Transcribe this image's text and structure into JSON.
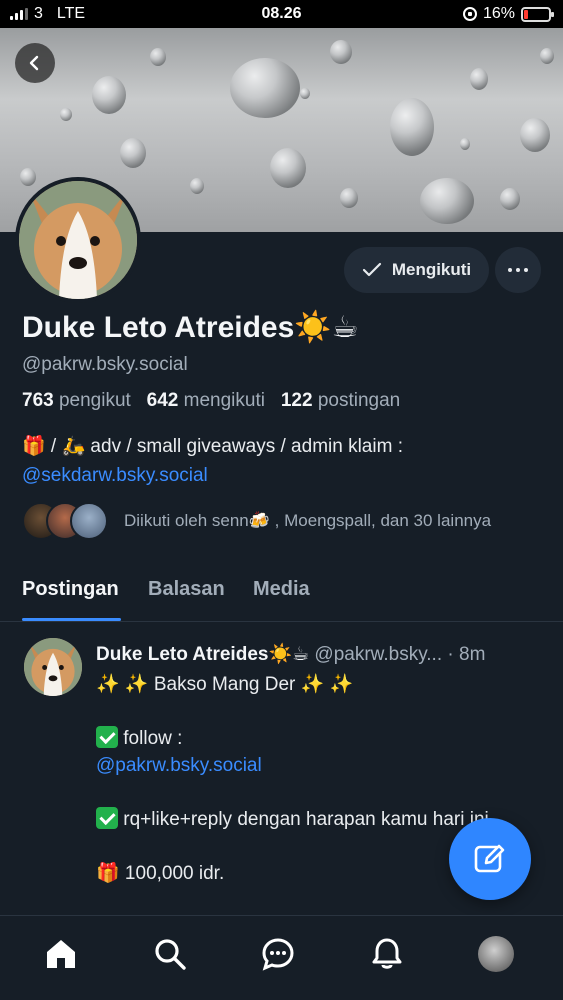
{
  "status_bar": {
    "carrier": "3",
    "network": "LTE",
    "time": "08.26",
    "battery": "16%",
    "battery_level": 0.16,
    "battery_color": "#ff3b30"
  },
  "profile": {
    "display_name": "Duke Leto Atreides☀️☕",
    "handle": "@pakrw.bsky.social",
    "followers_count": "763",
    "followers_label": "pengikut",
    "following_count": "642",
    "following_label": "mengikuti",
    "posts_count": "122",
    "posts_label": "postingan",
    "bio_text": "🎁 / 🛵 adv / small giveaways / admin klaim :",
    "bio_link": "@sekdarw.bsky.social",
    "followed_by": "Diikuti oleh senn🍻 , Moengspall, dan 30 lainnya",
    "follow_button": "Mengikuti"
  },
  "tabs": [
    {
      "label": "Postingan",
      "active": true
    },
    {
      "label": "Balasan",
      "active": false
    },
    {
      "label": "Media",
      "active": false
    }
  ],
  "post": {
    "author_name": "Duke Leto Atreides☀️☕",
    "author_handle": "@pakrw.bsky...",
    "time": "· 8m",
    "line1": "✨ ✨  Bakso Mang Der ✨ ✨",
    "line2": " follow :",
    "line3": "@pakrw.bsky.social",
    "line4": " rq+like+reply dengan harapan kamu hari ini.",
    "line5": "🎁 100,000 idr."
  },
  "colors": {
    "accent": "#3a8cff",
    "background": "#161e27",
    "muted": "#a2adb9"
  },
  "icons": [
    "back-icon",
    "check-icon",
    "more-icon",
    "compose-icon",
    "home-icon",
    "search-icon",
    "chat-icon",
    "bell-icon"
  ]
}
